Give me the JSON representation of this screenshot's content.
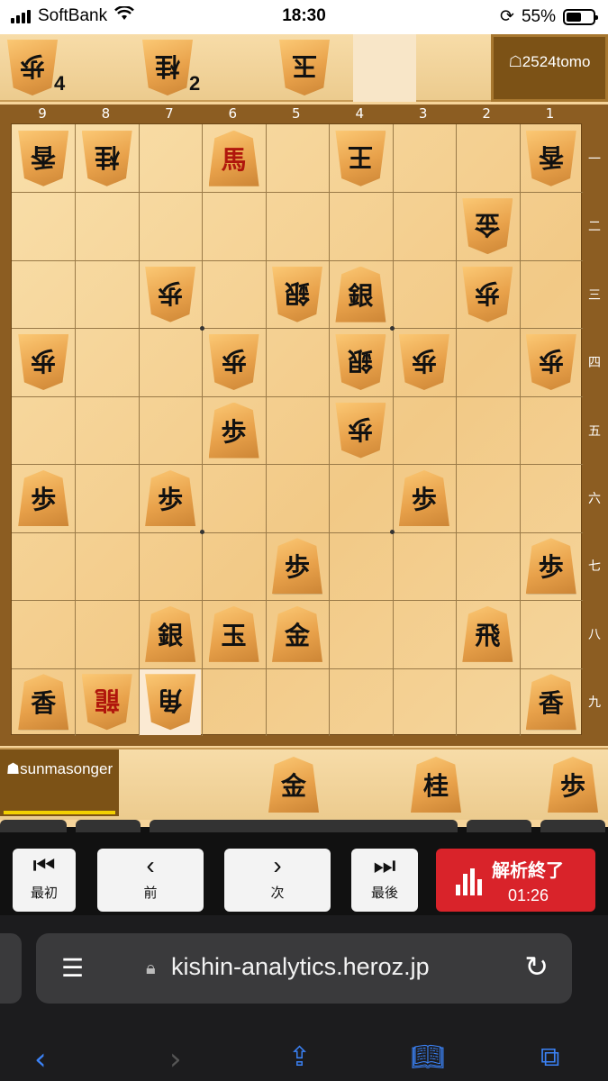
{
  "status_bar": {
    "carrier": "SoftBank",
    "time": "18:30",
    "battery": "55%"
  },
  "opponent": {
    "name": "☖2524tomo",
    "hand": [
      {
        "char": "歩",
        "count": "4"
      },
      {
        "char": "桂",
        "count": "2"
      },
      {
        "char": "玉",
        "count": ""
      }
    ]
  },
  "player": {
    "name": "☗sunmasonger",
    "hand": [
      {
        "char": "金"
      },
      {
        "char": "桂"
      },
      {
        "char": "歩"
      }
    ]
  },
  "board": {
    "file_labels": [
      "9",
      "8",
      "7",
      "6",
      "5",
      "4",
      "3",
      "2",
      "1"
    ],
    "rank_labels": [
      "一",
      "二",
      "三",
      "四",
      "五",
      "六",
      "七",
      "八",
      "九"
    ],
    "pieces": [
      {
        "file": 9,
        "rank": 1,
        "char": "香",
        "side": "gote"
      },
      {
        "file": 8,
        "rank": 1,
        "char": "桂",
        "side": "gote"
      },
      {
        "file": 6,
        "rank": 1,
        "char": "馬",
        "side": "sente",
        "promoted": true
      },
      {
        "file": 4,
        "rank": 1,
        "char": "王",
        "side": "gote"
      },
      {
        "file": 1,
        "rank": 1,
        "char": "香",
        "side": "gote"
      },
      {
        "file": 2,
        "rank": 2,
        "char": "金",
        "side": "gote"
      },
      {
        "file": 7,
        "rank": 3,
        "char": "歩",
        "side": "gote"
      },
      {
        "file": 5,
        "rank": 3,
        "char": "銀",
        "side": "gote"
      },
      {
        "file": 4,
        "rank": 3,
        "char": "銀",
        "side": "sente"
      },
      {
        "file": 2,
        "rank": 3,
        "char": "歩",
        "side": "gote"
      },
      {
        "file": 9,
        "rank": 4,
        "char": "歩",
        "side": "gote"
      },
      {
        "file": 6,
        "rank": 4,
        "char": "歩",
        "side": "gote"
      },
      {
        "file": 4,
        "rank": 4,
        "char": "銀",
        "side": "gote"
      },
      {
        "file": 3,
        "rank": 4,
        "char": "歩",
        "side": "gote"
      },
      {
        "file": 1,
        "rank": 4,
        "char": "歩",
        "side": "gote"
      },
      {
        "file": 6,
        "rank": 5,
        "char": "歩",
        "side": "sente"
      },
      {
        "file": 4,
        "rank": 5,
        "char": "歩",
        "side": "gote"
      },
      {
        "file": 9,
        "rank": 6,
        "char": "歩",
        "side": "sente"
      },
      {
        "file": 7,
        "rank": 6,
        "char": "歩",
        "side": "sente"
      },
      {
        "file": 3,
        "rank": 6,
        "char": "歩",
        "side": "sente"
      },
      {
        "file": 5,
        "rank": 7,
        "char": "歩",
        "side": "sente"
      },
      {
        "file": 1,
        "rank": 7,
        "char": "歩",
        "side": "sente"
      },
      {
        "file": 7,
        "rank": 8,
        "char": "銀",
        "side": "sente"
      },
      {
        "file": 6,
        "rank": 8,
        "char": "玉",
        "side": "sente"
      },
      {
        "file": 5,
        "rank": 8,
        "char": "金",
        "side": "sente"
      },
      {
        "file": 2,
        "rank": 8,
        "char": "飛",
        "side": "sente"
      },
      {
        "file": 9,
        "rank": 9,
        "char": "香",
        "side": "sente"
      },
      {
        "file": 8,
        "rank": 9,
        "char": "龍",
        "side": "gote",
        "promoted": true
      },
      {
        "file": 7,
        "rank": 9,
        "char": "角",
        "side": "gote"
      },
      {
        "file": 1,
        "rank": 9,
        "char": "香",
        "side": "sente"
      }
    ],
    "highlight": {
      "file": 7,
      "rank": 9
    }
  },
  "toolbar": {
    "first": {
      "icon": "⏮",
      "label": "最初"
    },
    "prev": {
      "icon": "‹",
      "label": "前"
    },
    "next": {
      "icon": "›",
      "label": "次"
    },
    "last": {
      "icon": "⏭",
      "label": "最後"
    },
    "analysis": {
      "label": "解析終了",
      "time": "01:26"
    }
  },
  "browser": {
    "url": "kishin-analytics.heroz.jp"
  },
  "colors": {
    "accent_red": "#d9232a",
    "piece_red": "#b0160c",
    "board": "#f2c986",
    "name_bg": "#7c5216"
  }
}
